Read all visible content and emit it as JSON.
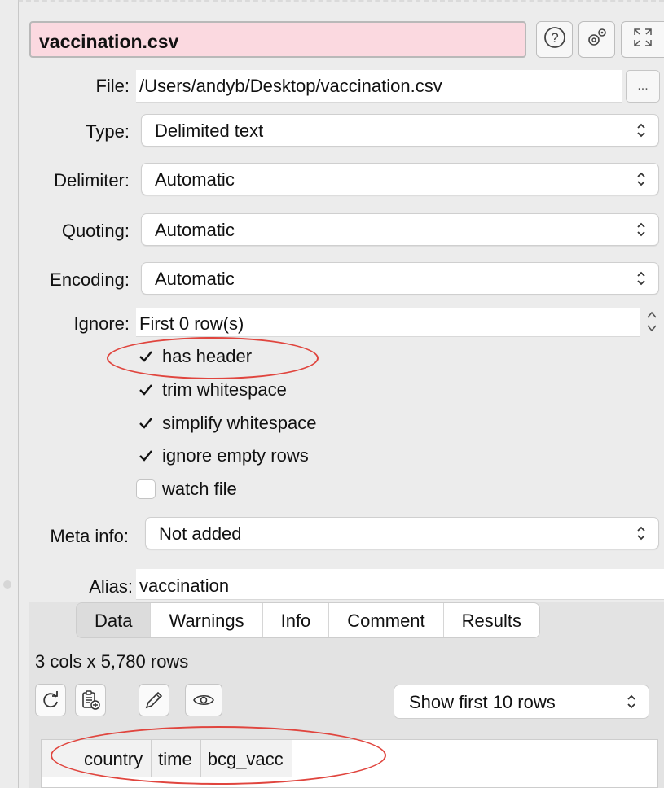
{
  "header": {
    "title": "vaccination.csv",
    "help_icon": "help-circle-icon",
    "settings_icon": "gears-icon",
    "expand_icon": "expand-arrows-icon"
  },
  "form": {
    "file_label": "File:",
    "file_value": "/Users/andyb/Desktop/vaccination.csv",
    "browse_label": "...",
    "type_label": "Type:",
    "type_value": "Delimited text",
    "delimiter_label": "Delimiter:",
    "delimiter_value": "Automatic",
    "quoting_label": "Quoting:",
    "quoting_value": "Automatic",
    "encoding_label": "Encoding:",
    "encoding_value": "Automatic",
    "ignore_label": "Ignore:",
    "ignore_value": "First 0 row(s)",
    "options": [
      {
        "label": "has header",
        "checked": true
      },
      {
        "label": "trim whitespace",
        "checked": true
      },
      {
        "label": "simplify whitespace",
        "checked": true
      },
      {
        "label": "ignore empty rows",
        "checked": true
      },
      {
        "label": "watch file",
        "checked": false
      }
    ],
    "meta_label": "Meta info:",
    "meta_value": "Not added",
    "alias_label": "Alias:",
    "alias_value": "vaccination"
  },
  "tabs": [
    {
      "label": "Data",
      "active": true
    },
    {
      "label": "Warnings",
      "active": false
    },
    {
      "label": "Info",
      "active": false
    },
    {
      "label": "Comment",
      "active": false
    },
    {
      "label": "Results",
      "active": false
    }
  ],
  "data_panel": {
    "status": "3 cols x 5,780 rows",
    "tools": [
      "refresh-icon",
      "clipboard-add-icon",
      "pencil-icon",
      "eye-icon"
    ],
    "rows_option": "Show first 10 rows",
    "columns": [
      "country",
      "time",
      "bcg_vacc"
    ]
  },
  "colors": {
    "title_bg": "#fbd9e0",
    "annotation": "#e0453e"
  }
}
